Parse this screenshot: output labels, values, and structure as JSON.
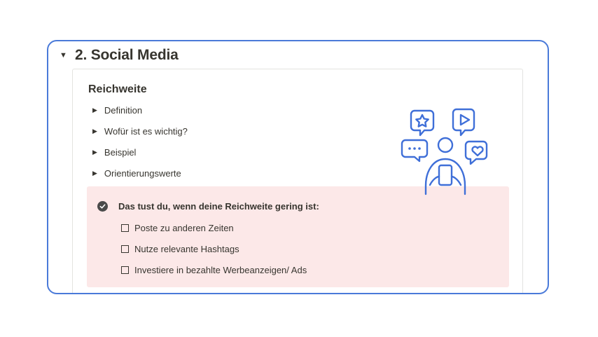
{
  "section": {
    "caret": "▼",
    "title": "2. Social Media"
  },
  "card": {
    "heading": "Reichweite",
    "toggles": [
      {
        "label": "Definition"
      },
      {
        "label": "Wofür ist es wichtig?"
      },
      {
        "label": "Beispiel"
      },
      {
        "label": "Orientierungswerte"
      }
    ],
    "callout": {
      "title": "Das tust du, wenn deine Reichweite gering ist:",
      "todos": [
        {
          "label": "Poste zu anderen Zeiten",
          "checked": false
        },
        {
          "label": "Nutze relevante Hashtags",
          "checked": false
        },
        {
          "label": "Investiere in bezahlte Werbeanzeigen/ Ads",
          "checked": false
        }
      ],
      "background": "#fce8e8"
    }
  },
  "illustration": {
    "icon": "social-media-user-icon",
    "color": "#3f6fd8"
  },
  "colors": {
    "frame_border": "#4a7ad9",
    "text": "#37352f"
  }
}
